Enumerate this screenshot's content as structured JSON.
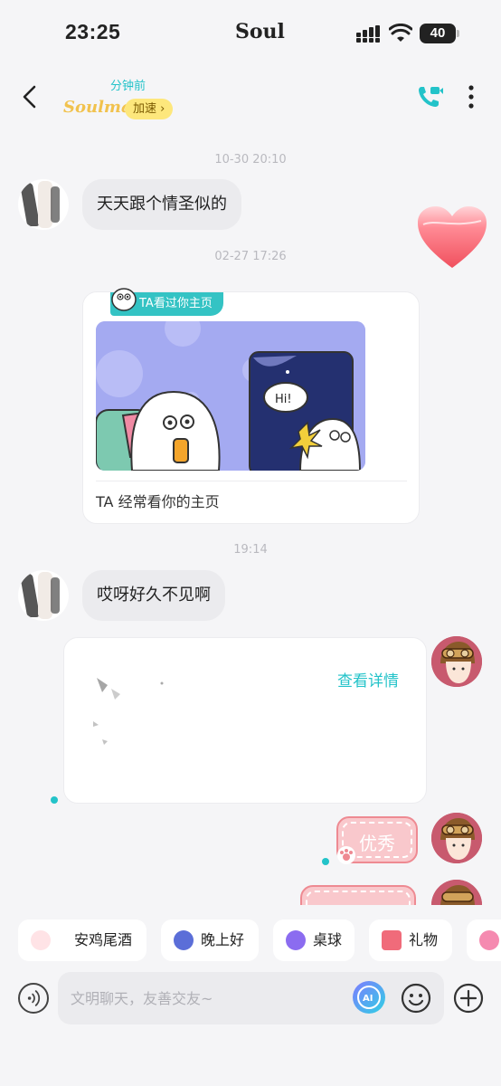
{
  "status_bar": {
    "time": "23:25",
    "app_name": "Soul",
    "battery": "40"
  },
  "header": {
    "last_seen": "分钟前",
    "relationship": "Soulmate",
    "speed_badge": "加速 ›"
  },
  "messages": {
    "ts1": "10-30 20:10",
    "msg1": "天天跟个情圣似的",
    "ts2": "02-27 17:26",
    "visit_card": {
      "tag": "TA看过你主页",
      "bubble": "Hi!",
      "text": "TA 经常看你的主页"
    },
    "ts3": "19:14",
    "msg2": "哎呀好久不见啊",
    "profile_card": {
      "link": "查看详情"
    },
    "sticker1": "优秀"
  },
  "chips": [
    {
      "label": "安鸡尾酒",
      "icon": "cocktail-icon"
    },
    {
      "label": "晚上好",
      "icon": "moon-icon"
    },
    {
      "label": "桌球",
      "icon": "billiard-icon"
    },
    {
      "label": "礼物",
      "icon": "gift-icon"
    }
  ],
  "input": {
    "placeholder": "文明聊天，友善交友~"
  },
  "colors": {
    "accent": "#23c3c9",
    "badge": "#fde77c",
    "sticker": "#f9c8cc"
  }
}
